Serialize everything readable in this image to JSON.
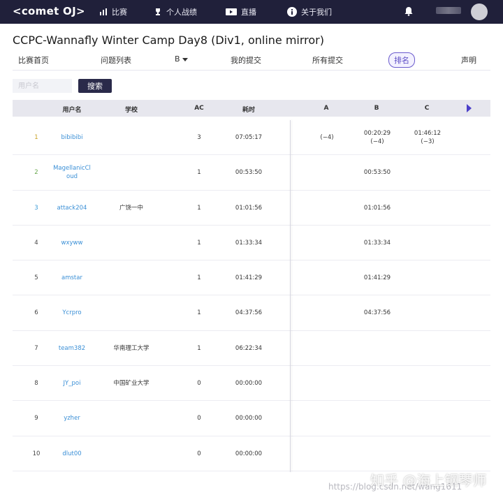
{
  "navbar": {
    "logo": "<comet OJ>",
    "items": [
      {
        "label": "比赛",
        "icon": "contest-icon"
      },
      {
        "label": "个人战绩",
        "icon": "trophy-icon"
      },
      {
        "label": "直播",
        "icon": "live-icon"
      },
      {
        "label": "关于我们",
        "icon": "info-icon"
      }
    ],
    "bell_icon": "bell-icon"
  },
  "page": {
    "title": "CCPC-Wannafly Winter Camp Day8 (Div1, online mirror)"
  },
  "tabs": [
    {
      "label": "比赛首页"
    },
    {
      "label": "问题列表"
    },
    {
      "label": "B"
    },
    {
      "label": "我的提交"
    },
    {
      "label": "所有提交"
    },
    {
      "label": "排名",
      "active": true
    },
    {
      "label": "声明"
    }
  ],
  "search": {
    "placeholder": "用户名",
    "button": "搜索"
  },
  "table": {
    "headers": [
      "用户名",
      "学校",
      "AC",
      "耗时",
      "A",
      "B",
      "C"
    ],
    "rows": [
      {
        "rank": "1",
        "user": "bibibibi",
        "school": "",
        "ac": "3",
        "time": "07:05:17",
        "a": "(−4)",
        "b": "00:20:29\n(−4)",
        "c": "01:46:12\n(−3)"
      },
      {
        "rank": "2",
        "user": "MagellanicCl\noud",
        "school": "",
        "ac": "1",
        "time": "00:53:50",
        "a": "",
        "b": "00:53:50",
        "c": ""
      },
      {
        "rank": "3",
        "user": "attack204",
        "school": "广饶一中",
        "ac": "1",
        "time": "01:01:56",
        "a": "",
        "b": "01:01:56",
        "c": ""
      },
      {
        "rank": "4",
        "user": "wxyww",
        "school": "",
        "ac": "1",
        "time": "01:33:34",
        "a": "",
        "b": "01:33:34",
        "c": ""
      },
      {
        "rank": "5",
        "user": "amstar",
        "school": "",
        "ac": "1",
        "time": "01:41:29",
        "a": "",
        "b": "01:41:29",
        "c": ""
      },
      {
        "rank": "6",
        "user": "Ycrpro",
        "school": "",
        "ac": "1",
        "time": "04:37:56",
        "a": "",
        "b": "04:37:56",
        "c": ""
      },
      {
        "rank": "7",
        "user": "team382",
        "school": "华南理工大学",
        "ac": "1",
        "time": "06:22:34",
        "a": "",
        "b": "",
        "c": ""
      },
      {
        "rank": "8",
        "user": "JY_poi",
        "school": "中国矿业大学",
        "ac": "0",
        "time": "00:00:00",
        "a": "",
        "b": "",
        "c": ""
      },
      {
        "rank": "9",
        "user": "yzher",
        "school": "",
        "ac": "0",
        "time": "00:00:00",
        "a": "",
        "b": "",
        "c": ""
      },
      {
        "rank": "10",
        "user": "dlut00",
        "school": "",
        "ac": "0",
        "time": "00:00:00",
        "a": "",
        "b": "",
        "c": ""
      }
    ]
  },
  "watermark": {
    "site": "知乎 @海上钢琴师",
    "url": "https://blog.csdn.net/wang1611"
  },
  "colors": {
    "navbar": "#20203a",
    "accent": "#5b4bc4",
    "link": "#3a8fd6"
  }
}
